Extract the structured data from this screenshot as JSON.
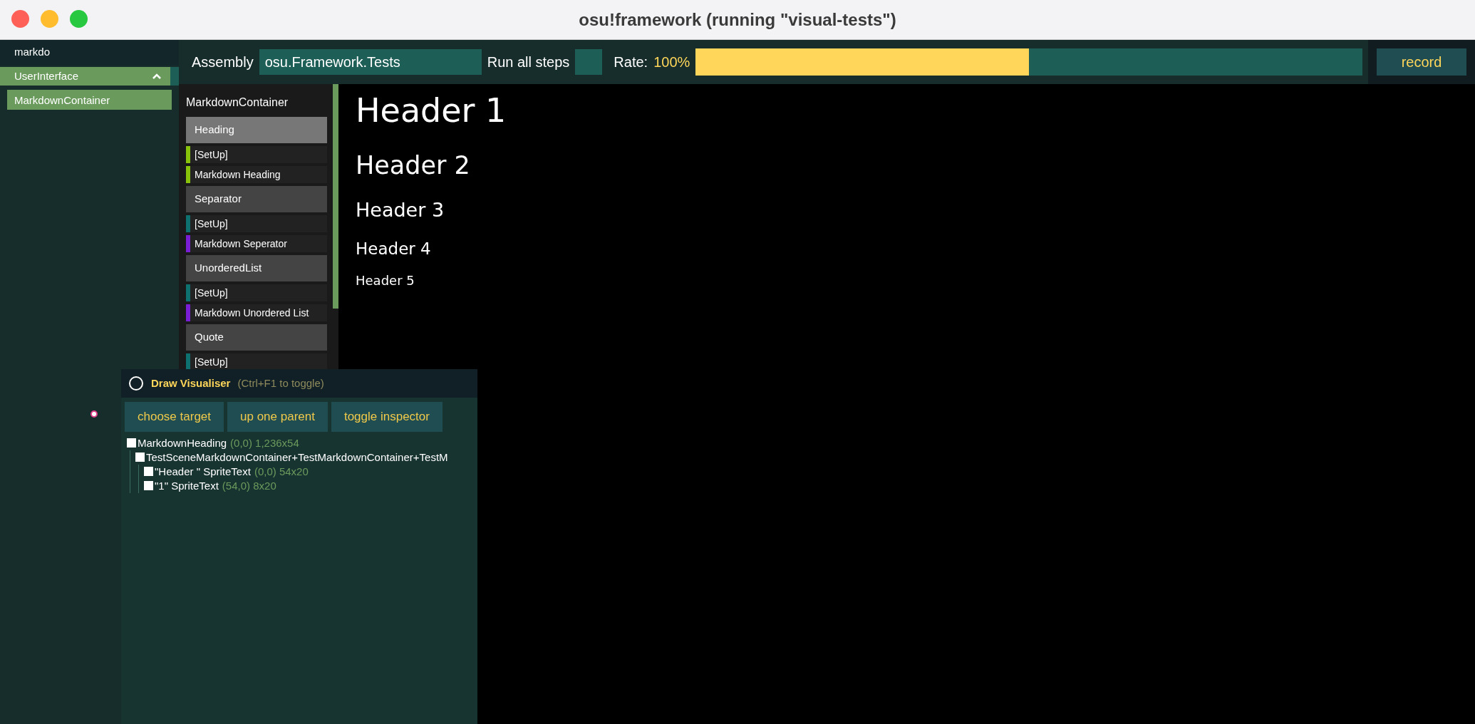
{
  "window": {
    "title": "osu!framework (running \"visual-tests\")"
  },
  "sidebar": {
    "search": {
      "value": "markdo"
    },
    "groups": [
      {
        "label": "UserInterface",
        "expanded": true,
        "items": [
          {
            "label": "MarkdownContainer",
            "selected": true
          }
        ]
      }
    ]
  },
  "toolbar": {
    "assembly_label": "Assembly",
    "assembly_value": "osu.Framework.Tests",
    "run_all_label": "Run all steps",
    "run_all_checked": false,
    "rate_label": "Rate:",
    "rate_value": "100%",
    "rate": {
      "level": 0.5
    },
    "record_button": "record"
  },
  "steps": {
    "title": "MarkdownContainer",
    "items": [
      {
        "kind": "group",
        "label": "Heading",
        "selected": true
      },
      {
        "kind": "step",
        "label": "[SetUp]",
        "color": "#88c20a"
      },
      {
        "kind": "step",
        "label": "Markdown Heading",
        "color": "#88c20a"
      },
      {
        "kind": "group",
        "label": "Separator",
        "selected": false
      },
      {
        "kind": "step",
        "label": "[SetUp]",
        "color": "#0f7070"
      },
      {
        "kind": "step",
        "label": "Markdown Seperator",
        "color": "#7a1ed6"
      },
      {
        "kind": "group",
        "label": "UnorderedList",
        "selected": false
      },
      {
        "kind": "step",
        "label": "[SetUp]",
        "color": "#0f7070"
      },
      {
        "kind": "step",
        "label": "Markdown Unordered List",
        "color": "#7a1ed6"
      },
      {
        "kind": "group",
        "label": "Quote",
        "selected": false
      },
      {
        "kind": "step",
        "label": "[SetUp]",
        "color": "#0f7070"
      }
    ]
  },
  "content": {
    "headings": [
      {
        "text": "Header 1",
        "kind": "h1"
      },
      {
        "text": "Header 2",
        "kind": "h2"
      },
      {
        "text": "Header 3",
        "kind": "h3"
      },
      {
        "text": "Header 4",
        "kind": "h4"
      },
      {
        "text": "Header 5",
        "kind": "h5"
      }
    ]
  },
  "draw_visualiser": {
    "title": "Draw Visualiser",
    "hint": "(Ctrl+F1 to toggle)",
    "buttons": [
      "choose target",
      "up one parent",
      "toggle inspector"
    ],
    "tree": [
      {
        "name": "MarkdownHeading",
        "info": "(0,0) 1,236x54",
        "children": [
          {
            "name": "TestSceneMarkdownContainer+TestMarkdownContainer+TestM",
            "children": [
              {
                "name": "\"Header \" SpriteText",
                "info": "(0,0) 54x20"
              },
              {
                "name": "\"1\" SpriteText",
                "info": "(54,0) 8x20"
              }
            ]
          }
        ]
      }
    ]
  }
}
